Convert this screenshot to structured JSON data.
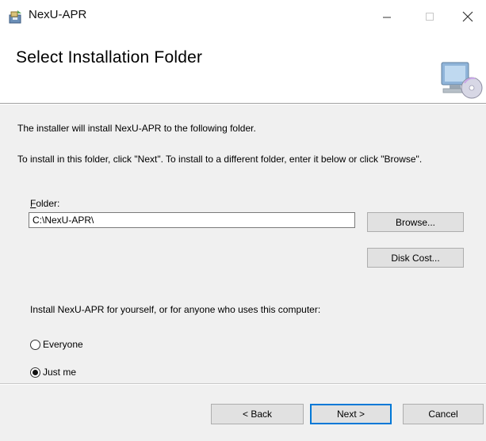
{
  "window": {
    "title": "NexU-APR",
    "icon": "installer-package-icon",
    "controls": [
      "minimize-icon",
      "maximize-icon",
      "close-icon"
    ]
  },
  "header": {
    "title": "Select Installation Folder",
    "icon": "computer-disc-icon"
  },
  "content": {
    "intro": "The installer will install NexU-APR to the following folder.",
    "instructions": "To install in this folder, click \"Next\". To install to a different folder, enter it below or click \"Browse\".",
    "folder_label_accel": "F",
    "folder_label_rest": "older:",
    "folder_value": "C:\\NexU-APR\\",
    "browse_label": "Browse...",
    "disk_cost_label": "Disk Cost...",
    "install_for_text": "Install NexU-APR for yourself, or for anyone who uses this computer:",
    "options": [
      {
        "label": "Everyone",
        "checked": false
      },
      {
        "label": "Just me",
        "checked": true
      }
    ]
  },
  "footer": {
    "back_label": "< Back",
    "next_label": "Next >",
    "cancel_label": "Cancel"
  },
  "colors": {
    "panel_bg": "#f0f0f0",
    "button_bg": "#e1e1e1",
    "default_button_border": "#0078d7"
  }
}
